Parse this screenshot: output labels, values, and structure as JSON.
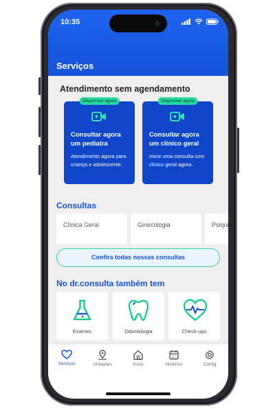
{
  "status": {
    "time": "10:35"
  },
  "header": {
    "title": "Serviços"
  },
  "walkin": {
    "title": "Atendimento sem agendamento",
    "cards": [
      {
        "badge": "Disponível agora",
        "title": "Consultar agora um pediatra",
        "desc": "Atendimento agora para criança e adolescente.",
        "icon": "video-camera-icon"
      },
      {
        "badge": "Disponível agora",
        "title": "Consultar agora um clínico geral",
        "desc": "Inicie uma consulta com clínico geral agora.",
        "icon": "video-camera-icon"
      }
    ]
  },
  "consultas": {
    "title": "Consultas",
    "items": [
      "Clínica Geral",
      "Ginecologia",
      "Psiquiatria"
    ],
    "cta": "Confira todas nossas consultas"
  },
  "services": {
    "title": "No dr.consulta também tem",
    "items": [
      {
        "label": "Exames",
        "icon": "flask-icon"
      },
      {
        "label": "Odontologia",
        "icon": "tooth-icon"
      },
      {
        "label": "Check-ups",
        "icon": "heart-pulse-icon"
      }
    ]
  },
  "tabbar": {
    "items": [
      {
        "label": "Serviços",
        "icon": "heart-icon",
        "active": true
      },
      {
        "label": "Unidades",
        "icon": "map-pin-icon"
      },
      {
        "label": "Início",
        "icon": "home-icon"
      },
      {
        "label": "Histórico",
        "icon": "calendar-icon"
      },
      {
        "label": "Config",
        "icon": "gear-icon"
      }
    ]
  },
  "colors": {
    "primary": "#1553d8",
    "card": "#0f45c8",
    "accent": "#27d9a0"
  }
}
